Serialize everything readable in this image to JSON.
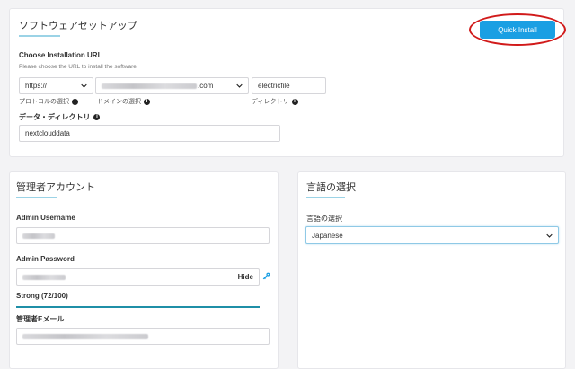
{
  "setup": {
    "title": "ソフトウェアセットアップ",
    "quick_install_label": "Quick Install",
    "choose_url_label": "Choose Installation URL",
    "choose_url_hint": "Please choose the URL to install the software",
    "protocol": {
      "value": "https://",
      "caption": "プロトコルの選択"
    },
    "domain": {
      "value_suffix": ".com",
      "caption": "ドメインの選択"
    },
    "directory": {
      "value": "electricfile",
      "caption": "ディレクトリ"
    },
    "data_dir_label": "データ・ディレクトリ",
    "data_dir_value": "nextclouddata"
  },
  "admin": {
    "title": "管理者アカウント",
    "username_label": "Admin Username",
    "password_label": "Admin Password",
    "hide_label": "Hide",
    "strength_text": "Strong (72/100)",
    "email_label": "管理者Eメール"
  },
  "language": {
    "title": "言語の選択",
    "select_label": "言語の選択",
    "selected": "Japanese"
  },
  "colors": {
    "accent": "#1a9fe3",
    "annotation": "#d11a1a",
    "underline": "#9bd3e6"
  },
  "icons": [
    "info-icon",
    "chevron-down-icon",
    "key-icon"
  ]
}
